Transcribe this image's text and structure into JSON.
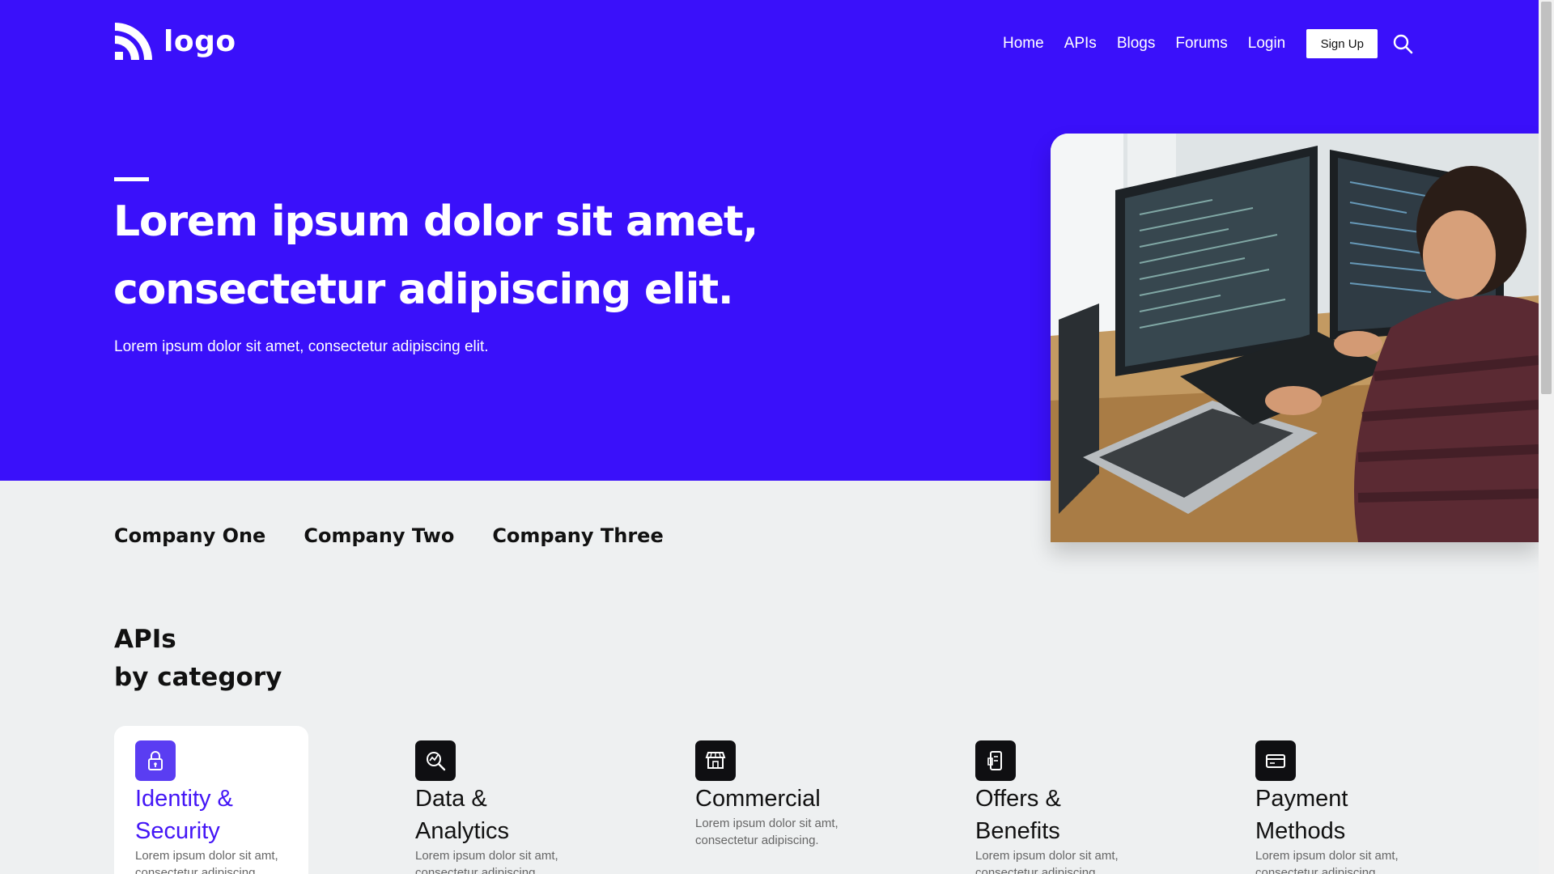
{
  "brand": {
    "logo_text": "logo",
    "accent": "#3a10fa",
    "card_accent": "#4416f6"
  },
  "nav": {
    "links": [
      "Home",
      "APIs",
      "Blogs",
      "Forums",
      "Login"
    ],
    "signup_label": "Sign Up",
    "search_icon": "search-icon"
  },
  "hero": {
    "title_line1": "Lorem ipsum dolor sit amet,",
    "title_line2": "consectetur adipiscing elit.",
    "subtitle": "Lorem ipsum dolor sit amet, consectetur adipiscing elit."
  },
  "companies": [
    "Company One",
    "Company Two",
    "Company Three"
  ],
  "apis": {
    "title_line1": "APIs",
    "title_line2": "by category",
    "cards": [
      {
        "icon": "lock-icon",
        "title_line1": "Identity &",
        "title_line2": "Security",
        "desc": "Lorem ipsum dolor sit amt, consectetur adipiscing.",
        "active": true
      },
      {
        "icon": "analytics-icon",
        "title_line1": "Data &",
        "title_line2": "Analytics",
        "desc": "Lorem ipsum dolor sit amt, consectetur adipiscing.",
        "active": false
      },
      {
        "icon": "store-icon",
        "title_line1": "Commercial",
        "title_line2": "",
        "desc": "Lorem ipsum dolor sit amt, consectetur adipiscing.",
        "active": false
      },
      {
        "icon": "mobile-offer-icon",
        "title_line1": "Offers &",
        "title_line2": "Benefits",
        "desc": "Lorem ipsum dolor sit amt, consectetur adipiscing.",
        "active": false
      },
      {
        "icon": "credit-card-icon",
        "title_line1": "Payment",
        "title_line2": "Methods",
        "desc": "Lorem ipsum dolor sit amt, consectetur adipiscing.",
        "active": false
      }
    ]
  }
}
